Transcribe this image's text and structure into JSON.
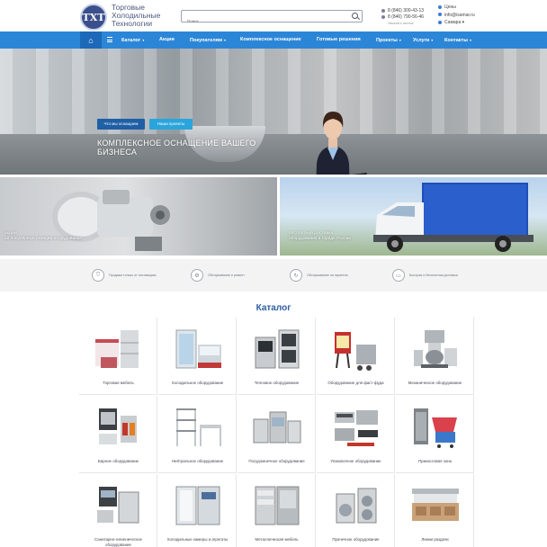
{
  "header": {
    "logo_text": "ТХТ",
    "brand_lines": [
      "Торговые",
      "Холодильные",
      "Технологии"
    ],
    "search_placeholder": "Поиск",
    "phones": [
      "8 (846) 300-43-13",
      "8 (846) 790-56-46"
    ],
    "phones_note": "Заказать звонок",
    "contacts": [
      "Цены",
      "info@isamar.ru",
      "Самара"
    ]
  },
  "nav": {
    "items": [
      {
        "label": "Каталог",
        "caret": true
      },
      {
        "label": "Акции",
        "caret": false
      },
      {
        "label": "Покупателям",
        "caret": true
      },
      {
        "label": "Комплексное оснащение",
        "caret": false
      },
      {
        "label": "Готовые решения",
        "caret": false
      },
      {
        "label": "Проекты",
        "caret": true
      },
      {
        "label": "Услуги",
        "caret": true
      },
      {
        "label": "Контакты",
        "caret": true
      }
    ]
  },
  "hero": {
    "title_line1": "КОМПЛЕКСНОЕ ОСНАЩЕНИЕ ВАШЕГО",
    "title_line2": "БИЗНЕСА",
    "btn_primary": "Что мы оснащаем",
    "btn_secondary": "Наши проекты",
    "slides_total": 8,
    "slide_active": 1
  },
  "promos": {
    "left": {
      "line1": "АКЦИИ",
      "line2": "на популярные позиции оборудования"
    },
    "right": {
      "line1": "БЕСПЛАТНАЯ ДОСТАВКА",
      "line2": "оборудования в городе России"
    }
  },
  "features": [
    {
      "icon": "shield-icon",
      "text": "Продажи только от поставщика"
    },
    {
      "icon": "gear-icon",
      "text": "Обслуживание и ремонт"
    },
    {
      "icon": "refresh-icon",
      "text": "Обслуживание на гарантии"
    },
    {
      "icon": "truck-icon",
      "text": "Быстрая и бесплатная доставка"
    }
  ],
  "catalog": {
    "title": "Каталог",
    "items": [
      "Торговая мебель",
      "Холодильное оборудование",
      "Тепловое оборудование",
      "Оборудование для фаст-фуда",
      "Механическое оборудование",
      "Барное оборудование",
      "Нейтральное оборудование",
      "Посудомоечное оборудование",
      "Упаковочное оборудование",
      "Прикассовая зона",
      "Санитарно-гигиеническое оборудование",
      "Холодильные камеры и агрегаты",
      "Металлическая мебель",
      "Прачечное оборудование",
      "Линии раздачи"
    ]
  },
  "colors": {
    "nav": "#2c86d8",
    "nav_active": "#1c69b9",
    "accent_title": "#2f5da3",
    "btn_primary": "#1f5fa6",
    "btn_secondary": "#2aa5dc"
  }
}
